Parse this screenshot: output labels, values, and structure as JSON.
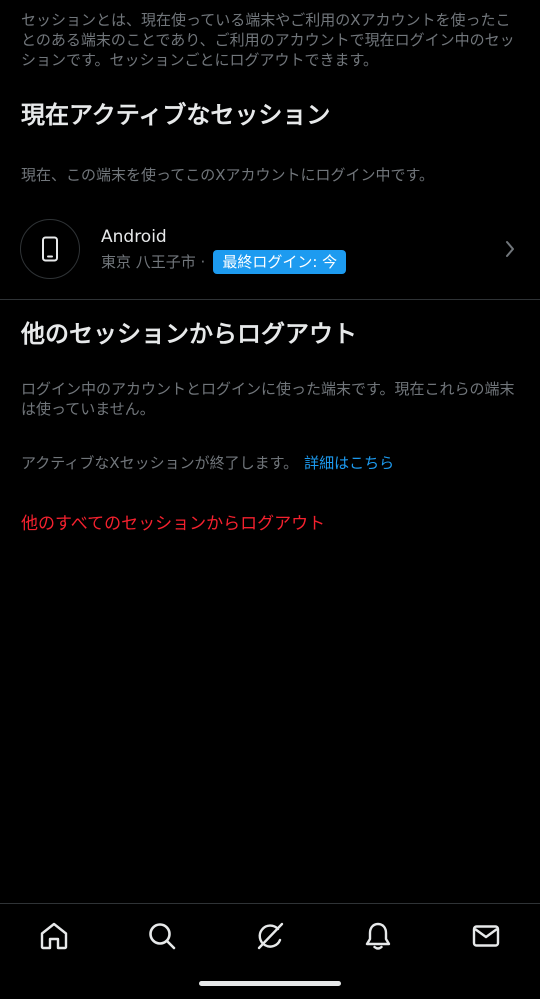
{
  "intro": "セッションとは、現在使っている端末やご利用のXアカウントを使ったことのある端末のことであり、ご利用のアカウントで現在ログイン中のセッションです。セッションごとにログアウトできます。",
  "active": {
    "title": "現在アクティブなセッション",
    "description": "現在、この端末を使ってこのXアカウントにログイン中です。",
    "session": {
      "device": "Android",
      "location": "東京 八王子市 ·",
      "badge": "最終ログイン: 今",
      "icon": "phone-icon"
    }
  },
  "others": {
    "title": "他のセッションからログアウト",
    "description": "ログイン中のアカウントとログインに使った端末です。現在これらの端末は使っていません。",
    "note": "アクティブなXセッションが終了します。",
    "link": "詳細はこちら",
    "logout_all": "他のすべてのセッションからログアウト"
  },
  "tabs": [
    {
      "name": "home-icon"
    },
    {
      "name": "search-icon"
    },
    {
      "name": "grok-icon"
    },
    {
      "name": "bell-icon"
    },
    {
      "name": "mail-icon"
    }
  ],
  "colors": {
    "background": "#000000",
    "text": "#e7e9ea",
    "muted": "#71767b",
    "accent": "#1d9bf0",
    "danger": "#f4212e",
    "divider": "#2f3336"
  }
}
